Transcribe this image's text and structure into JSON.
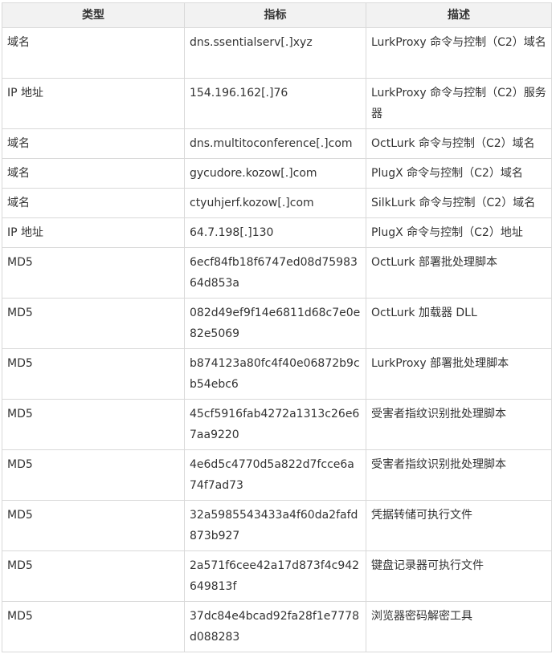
{
  "table": {
    "headers": [
      "类型",
      "指标",
      "描述"
    ],
    "rows": [
      {
        "type": "域名",
        "indicator": "dns.ssentialserv[.]xyz",
        "description": "LurkProxy 命令与控制（C2）域名"
      },
      {
        "type": "IP 地址",
        "indicator": "154.196.162[.]76",
        "description": "LurkProxy 命令与控制（C2）服务器"
      },
      {
        "type": "域名",
        "indicator": "dns.multitoconference[.]com",
        "description": "OctLurk 命令与控制（C2）域名"
      },
      {
        "type": "域名",
        "indicator": "gycudore.kozow[.]com",
        "description": "PlugX 命令与控制（C2）域名"
      },
      {
        "type": "域名",
        "indicator": "ctyuhjerf.kozow[.]com",
        "description": "SilkLurk 命令与控制（C2）域名"
      },
      {
        "type": "IP 地址",
        "indicator": "64.7.198[.]130",
        "description": "PlugX 命令与控制（C2）地址"
      },
      {
        "type": "MD5",
        "indicator": "6ecf84fb18f6747ed08d7598364d853a",
        "description": "OctLurk 部署批处理脚本"
      },
      {
        "type": "MD5",
        "indicator": "082d49ef9f14e6811d68c7e0e82e5069",
        "description": "OctLurk 加载器 DLL"
      },
      {
        "type": "MD5",
        "indicator": "b874123a80fc4f40e06872b9cb54ebc6",
        "description": "LurkProxy 部署批处理脚本"
      },
      {
        "type": "MD5",
        "indicator": "45cf5916fab4272a1313c26e67aa9220",
        "description": "受害者指纹识别批处理脚本"
      },
      {
        "type": "MD5",
        "indicator": "4e6d5c4770d5a822d7fcce6a74f7ad73",
        "description": "受害者指纹识别批处理脚本"
      },
      {
        "type": "MD5",
        "indicator": "32a5985543433a4f60da2fafd873b927",
        "description": "凭据转储可执行文件"
      },
      {
        "type": "MD5",
        "indicator": "2a571f6cee42a17d873f4c942649813f",
        "description": "键盘记录器可执行文件"
      },
      {
        "type": "MD5",
        "indicator": "37dc84e4bcad92fa28f1e7778d088283",
        "description": "浏览器密码解密工具"
      }
    ]
  }
}
